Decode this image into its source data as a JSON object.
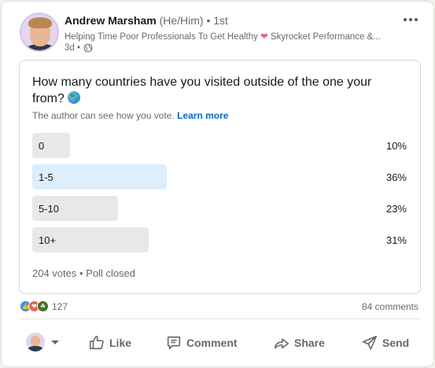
{
  "author": {
    "name": "Andrew Marsham",
    "pronouns": "(He/Him)",
    "connection": " • 1st",
    "headline_prefix": "Helping Time Poor Professionals To Get Healthy ",
    "headline_suffix": " Skyrocket Performance &...",
    "age": "3d •"
  },
  "poll": {
    "question": "How many countries have you visited outside of the one your from? ",
    "visibility_text": "The author can see how you vote. ",
    "learn_more": "Learn more",
    "options": [
      {
        "label": "0",
        "percent": "10%",
        "fill": 0.1
      },
      {
        "label": "1-5",
        "percent": "36%",
        "fill": 0.36,
        "leading": true
      },
      {
        "label": "5-10",
        "percent": "23%",
        "fill": 0.23
      },
      {
        "label": "10+",
        "percent": "31%",
        "fill": 0.31
      }
    ],
    "footer": "204 votes • Poll closed"
  },
  "social": {
    "reaction_count": "127",
    "comments": "84 comments"
  },
  "actions": {
    "like": "Like",
    "comment": "Comment",
    "share": "Share",
    "send": "Send"
  },
  "colors": {
    "accent": "#0a66c2",
    "leading_bar": "#ddeefc",
    "bar": "#e8e8e8"
  }
}
